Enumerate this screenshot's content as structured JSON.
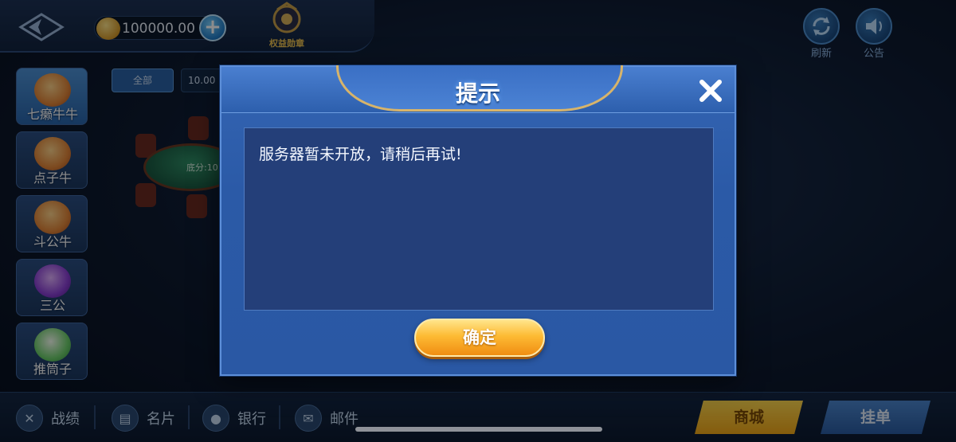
{
  "topbar": {
    "coins": "100000.00",
    "add_symbol": "+",
    "medal_label": "权益勋章",
    "refresh_label": "刷新",
    "notice_label": "公告"
  },
  "filters": {
    "all_label": "全部",
    "other_label": "10.00"
  },
  "games": [
    {
      "name": "七癞牛牛",
      "icon": "bull-mascot-icon"
    },
    {
      "name": "点子牛",
      "icon": "bull-mascot-icon"
    },
    {
      "name": "斗公牛",
      "icon": "bull-mascot-icon"
    },
    {
      "name": "三公",
      "icon": "chip-icon"
    },
    {
      "name": "推筒子",
      "icon": "mahjong-tile-icon"
    }
  ],
  "table": {
    "label": "底分:10"
  },
  "bottom": {
    "record_label": "战绩",
    "card_label": "名片",
    "bank_label": "银行",
    "mail_label": "邮件",
    "shop_label": "商城",
    "order_label": "挂单"
  },
  "modal": {
    "title": "提示",
    "message": "服务器暂未开放，请稍后再试!",
    "confirm_label": "确定"
  }
}
